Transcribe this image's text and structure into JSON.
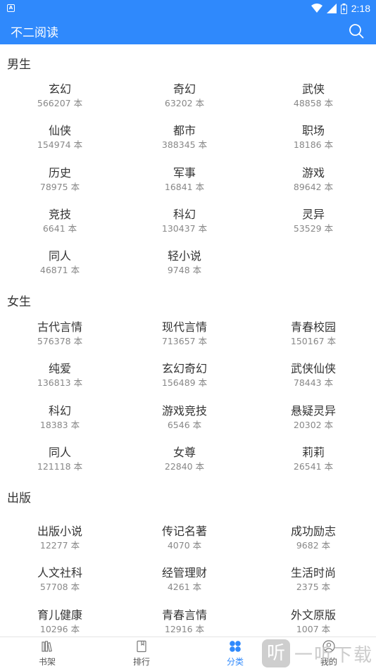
{
  "status_bar": {
    "time": "2:18",
    "notification_icon": "a-icon",
    "icons": [
      "wifi-icon",
      "signal-icon",
      "battery-icon"
    ]
  },
  "toolbar": {
    "title": "不二阅读",
    "search_icon": "search-icon"
  },
  "sections": [
    {
      "title": "男生",
      "items": [
        {
          "name": "玄幻",
          "count": "566207 本"
        },
        {
          "name": "奇幻",
          "count": "63202 本"
        },
        {
          "name": "武侠",
          "count": "48858 本"
        },
        {
          "name": "仙侠",
          "count": "154974 本"
        },
        {
          "name": "都市",
          "count": "388345 本"
        },
        {
          "name": "职场",
          "count": "18186 本"
        },
        {
          "name": "历史",
          "count": "78975 本"
        },
        {
          "name": "军事",
          "count": "16841 本"
        },
        {
          "name": "游戏",
          "count": "89642 本"
        },
        {
          "name": "竞技",
          "count": "6641 本"
        },
        {
          "name": "科幻",
          "count": "130437 本"
        },
        {
          "name": "灵异",
          "count": "53529 本"
        },
        {
          "name": "同人",
          "count": "46871 本"
        },
        {
          "name": "轻小说",
          "count": "9748 本"
        }
      ]
    },
    {
      "title": "女生",
      "items": [
        {
          "name": "古代言情",
          "count": "576378 本"
        },
        {
          "name": "现代言情",
          "count": "713657 本"
        },
        {
          "name": "青春校园",
          "count": "150167 本"
        },
        {
          "name": "纯爱",
          "count": "136813 本"
        },
        {
          "name": "玄幻奇幻",
          "count": "156489 本"
        },
        {
          "name": "武侠仙侠",
          "count": "78443 本"
        },
        {
          "name": "科幻",
          "count": "18383 本"
        },
        {
          "name": "游戏竞技",
          "count": "6546 本"
        },
        {
          "name": "悬疑灵异",
          "count": "20302 本"
        },
        {
          "name": "同人",
          "count": "121118 本"
        },
        {
          "name": "女尊",
          "count": "22840 本"
        },
        {
          "name": "莉莉",
          "count": "26541 本"
        }
      ]
    },
    {
      "title": "出版",
      "items": [
        {
          "name": "出版小说",
          "count": "12277 本"
        },
        {
          "name": "传记名著",
          "count": "4070 本"
        },
        {
          "name": "成功励志",
          "count": "9682 本"
        },
        {
          "name": "人文社科",
          "count": "57708 本"
        },
        {
          "name": "经管理财",
          "count": "4261 本"
        },
        {
          "name": "生活时尚",
          "count": "2375 本"
        },
        {
          "name": "育儿健康",
          "count": "10296 本"
        },
        {
          "name": "青春言情",
          "count": "12916 本"
        },
        {
          "name": "外文原版",
          "count": "1007 本"
        }
      ]
    }
  ],
  "tabs": [
    {
      "label": "书架",
      "icon": "bookshelf-icon",
      "active": false
    },
    {
      "label": "排行",
      "icon": "ranking-icon",
      "active": false
    },
    {
      "label": "分类",
      "icon": "category-icon",
      "active": true
    },
    {
      "label": "我的",
      "icon": "profile-icon",
      "active": false
    }
  ],
  "watermark": {
    "logo_text": "听",
    "text": "一听下载"
  },
  "colors": {
    "accent": "#2f89fc",
    "text": "#333333",
    "muted": "#888888"
  }
}
